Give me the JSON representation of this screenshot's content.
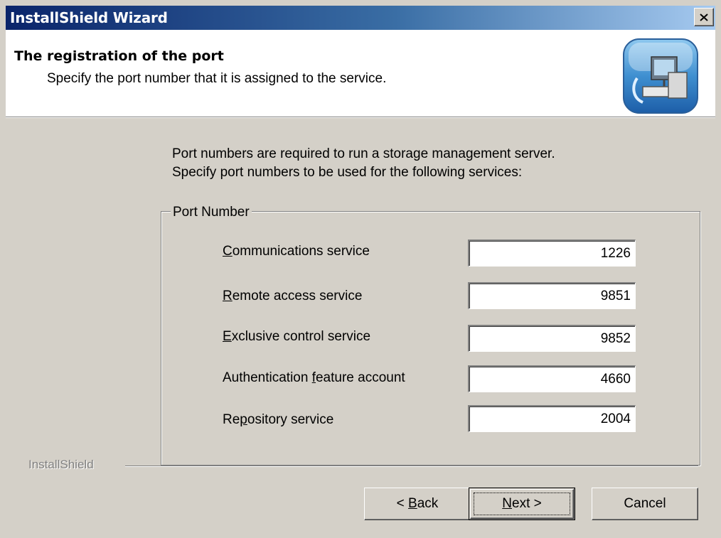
{
  "window": {
    "title": "InstallShield Wizard",
    "colors": {
      "titlebar_start": "#0a246a",
      "titlebar_end": "#a6caf0",
      "face": "#d4d0c8"
    }
  },
  "header": {
    "title": "The registration of the port",
    "subtitle": "Specify the port number that it is assigned to the service.",
    "icon": "computer-setup-icon"
  },
  "intro": {
    "line1": "Port numbers are required to run a storage management server.",
    "line2": "Specify port numbers to be used for the following services:"
  },
  "group": {
    "legend": "Port Number",
    "fields": [
      {
        "label_pre": "",
        "label_key": "C",
        "label_post": "ommunications service",
        "value": "1226"
      },
      {
        "label_pre": "",
        "label_key": "R",
        "label_post": "emote access service",
        "value": "9851"
      },
      {
        "label_pre": "",
        "label_key": "E",
        "label_post": "xclusive control service",
        "value": "9852"
      },
      {
        "label_pre": "Authentication ",
        "label_key": "f",
        "label_post": "eature account",
        "value": "4660"
      },
      {
        "label_pre": "Re",
        "label_key": "p",
        "label_post": "ository service",
        "value": "2004"
      }
    ]
  },
  "footer": {
    "brand": "InstallShield",
    "back_pre": "< ",
    "back_key": "B",
    "back_post": "ack",
    "next_key": "N",
    "next_post": "ext >",
    "cancel": "Cancel"
  }
}
